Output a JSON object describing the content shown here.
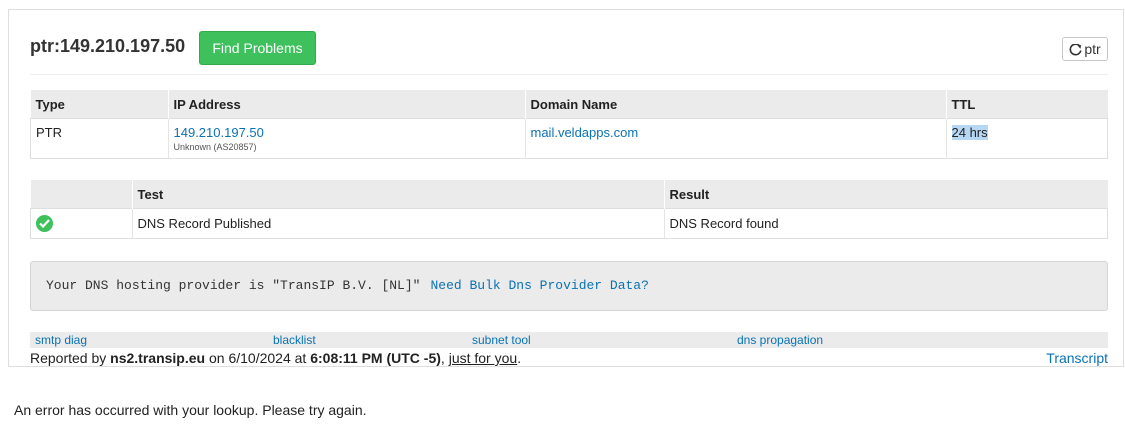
{
  "header": {
    "title": "ptr:149.210.197.50",
    "find_button": "Find Problems",
    "ptr_button": "ptr"
  },
  "records_table": {
    "columns": [
      "Type",
      "IP Address",
      "Domain Name",
      "TTL"
    ],
    "rows": [
      {
        "type": "PTR",
        "ip": "149.210.197.50",
        "ip_note": "Unknown (AS20857)",
        "domain": "mail.veldapps.com",
        "ttl": "24 hrs"
      }
    ]
  },
  "test_table": {
    "columns": [
      "",
      "Test",
      "Result"
    ],
    "rows": [
      {
        "status_icon": "check-circle-icon",
        "test": "DNS Record Published",
        "result": "DNS Record found"
      }
    ]
  },
  "dns_provider": {
    "text": "Your DNS hosting provider is \"TransIP B.V. [NL]\"",
    "link": "Need Bulk Dns Provider Data?"
  },
  "links": {
    "smtp_diag": "smtp diag",
    "blacklist": "blacklist",
    "subnet_tool": "subnet tool",
    "dns_propagation": "dns propagation"
  },
  "footer": {
    "reported_by_prefix": "Reported by ",
    "server": "ns2.transip.eu",
    "on": " on ",
    "date": "6/10/2024",
    "at": " at ",
    "time": "6:08:11 PM (UTC -5)",
    "comma": ", ",
    "just_for_you": "just for you",
    "period": ".",
    "transcript": "Transcript"
  },
  "error_message": "An error has occurred with your lookup. Please try again.",
  "colors": {
    "accent_green": "#3ec15d",
    "link_blue": "#0a72b4",
    "header_gray": "#ebebeb"
  }
}
